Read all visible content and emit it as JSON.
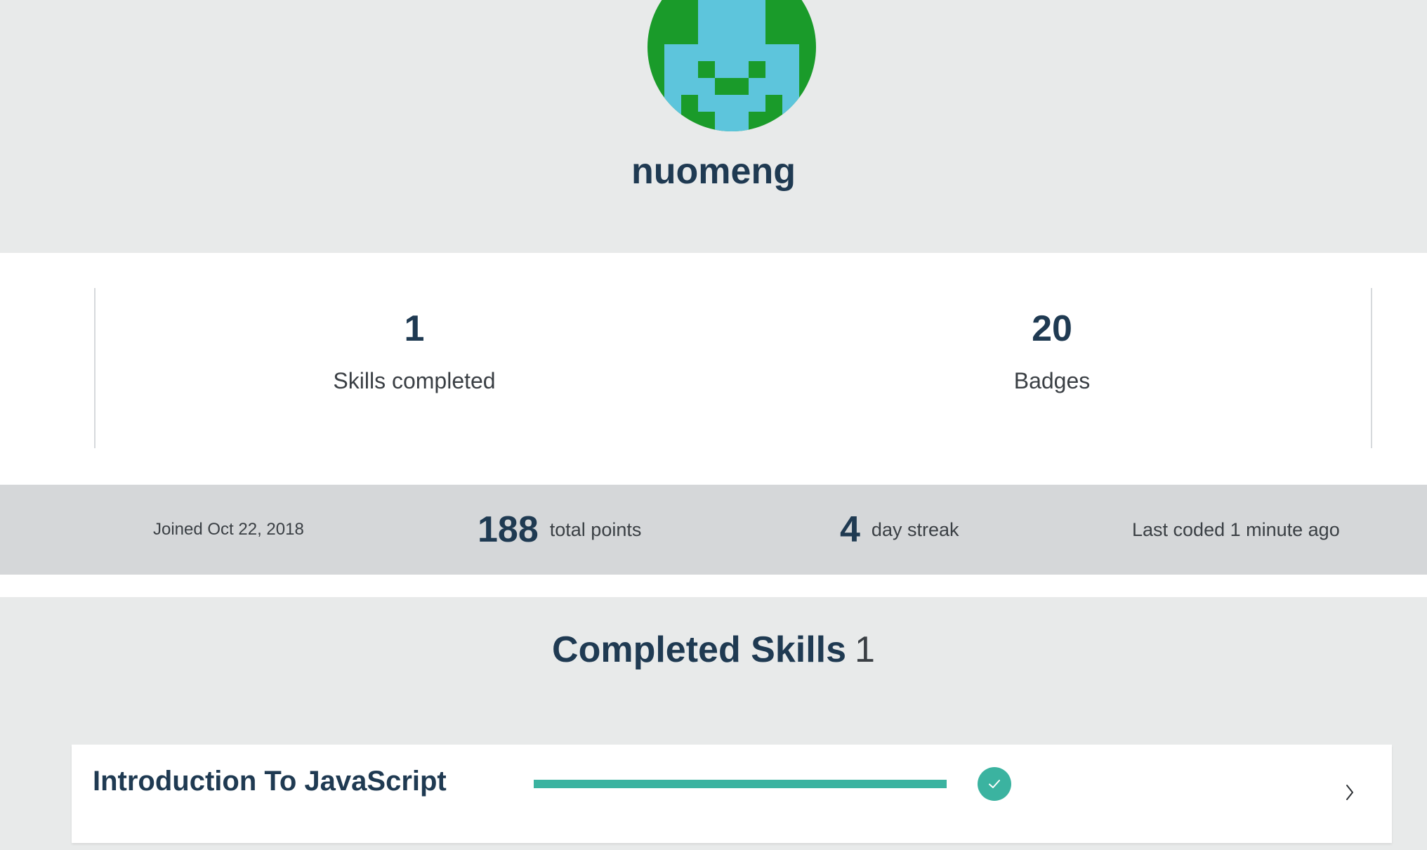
{
  "profile": {
    "username": "nuomeng",
    "avatar_colors": {
      "primary": "#1a9b2a",
      "secondary": "#5dc5dc"
    }
  },
  "stats": {
    "skills_completed": {
      "value": "1",
      "label": "Skills completed"
    },
    "badges": {
      "value": "20",
      "label": "Badges"
    }
  },
  "info_bar": {
    "joined": "Joined Oct 22, 2018",
    "total_points_value": "188",
    "total_points_label": "total points",
    "streak_value": "4",
    "streak_label": "day streak",
    "last_coded": "Last coded 1 minute ago"
  },
  "completed_skills": {
    "title": "Completed Skills",
    "count": "1",
    "items": [
      {
        "name": "Introduction To JavaScript",
        "progress": 1.0,
        "completed": true
      }
    ]
  },
  "icons": {
    "check": "check-icon",
    "chevron": "chevron-right-icon"
  },
  "colors": {
    "accent": "#3bb3a0",
    "heading": "#1f3a52"
  }
}
